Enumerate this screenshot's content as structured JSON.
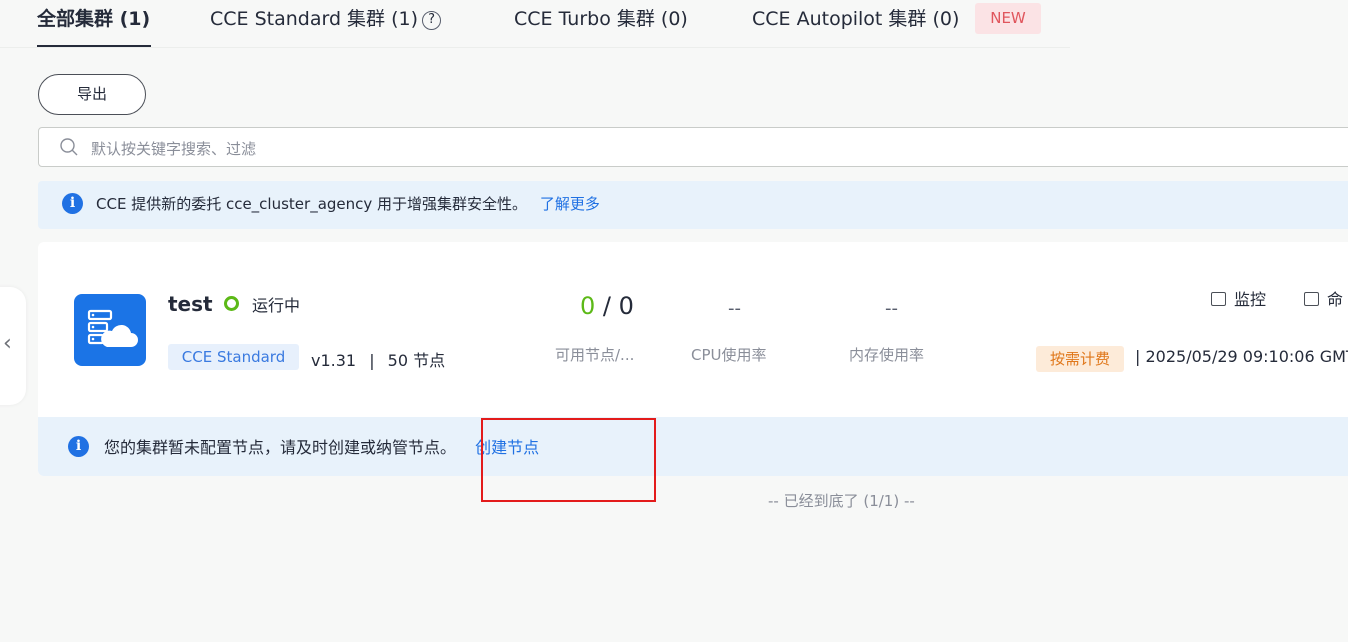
{
  "tabs": [
    {
      "label": "全部集群 (1)"
    },
    {
      "label": "CCE Standard 集群 (1)"
    },
    {
      "label": "CCE Turbo 集群 (0)"
    },
    {
      "label": "CCE Autopilot 集群 (0)"
    }
  ],
  "new_badge": "NEW",
  "toolbar": {
    "export_label": "导出"
  },
  "search": {
    "placeholder": "默认按关键字搜索、过滤"
  },
  "info_banner": {
    "text": "CCE 提供新的委托 cce_cluster_agency 用于增强集群安全性。",
    "link": "了解更多"
  },
  "cluster": {
    "name": "test",
    "status": "运行中",
    "type_tag": "CCE Standard",
    "version": "v1.31",
    "separator": "|",
    "nodes": "50 节点",
    "metrics": {
      "available_nodes": "0",
      "slash_total": " / 0",
      "available_nodes_label": "可用节点/...",
      "cpu_value": "--",
      "cpu_label": "CPU使用率",
      "mem_value": "--",
      "mem_label": "内存使用率"
    },
    "actions": {
      "monitor": "监控",
      "command": "命"
    },
    "billing_tag": "按需计费",
    "created_time": "|  2025/05/29 09:10:06 GMT",
    "node_notice": "您的集群暂未配置节点，请及时创建或纳管节点。",
    "create_node_link": "创建节点"
  },
  "footer": "-- 已经到底了 (1/1) --",
  "colors": {
    "accent": "#2071e3",
    "running": "#5cb917",
    "highlight": "#e31b1b",
    "new_badge": "#e0565d",
    "billing": "#e0771a"
  }
}
